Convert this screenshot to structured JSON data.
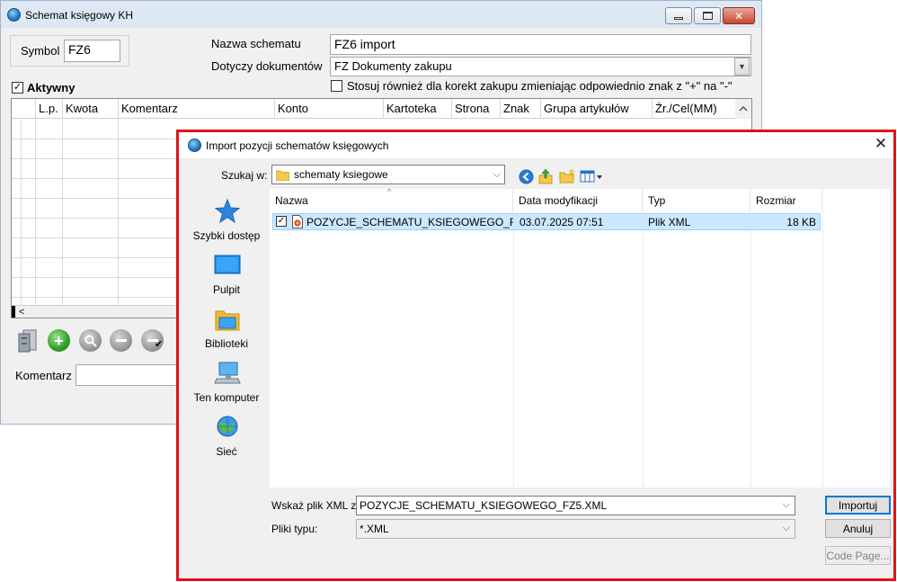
{
  "main_window": {
    "title": "Schemat księgowy KH",
    "controls": {
      "minimize": "▭",
      "maximize": "□",
      "close": "✕"
    },
    "symbol_label": "Symbol",
    "symbol_value": "FZ6",
    "scheme_name_label": "Nazwa schematu",
    "scheme_name_value": "FZ6 import",
    "documents_label": "Dotyczy dokumentów",
    "documents_value": "FZ Dokumenty zakupu",
    "active_label": "Aktywny",
    "active_checked": true,
    "corrections_label": "Stosuj również dla korekt zakupu zmieniając odpowiednio znak z \"+\" na \"-\"",
    "corrections_checked": false,
    "grid_columns": [
      "L.p.",
      "Kwota",
      "Komentarz",
      "Konto",
      "Kartoteka",
      "Strona",
      "Znak",
      "Grupa artykułów",
      "Źr./Cel(MM)"
    ],
    "comment_label": "Komentarz",
    "comment_value": ""
  },
  "dialog": {
    "title": "Import pozycji schematów księgowych",
    "look_in_label": "Szukaj w:",
    "look_in_value": "schematy ksiegowe",
    "places": [
      {
        "label": "Szybki dostęp",
        "icon": "star-icon"
      },
      {
        "label": "Pulpit",
        "icon": "desktop-icon"
      },
      {
        "label": "Biblioteki",
        "icon": "libraries-icon"
      },
      {
        "label": "Ten komputer",
        "icon": "computer-icon"
      },
      {
        "label": "Sieć",
        "icon": "network-icon"
      }
    ],
    "columns": [
      "Nazwa",
      "Data modyfikacji",
      "Typ",
      "Rozmiar"
    ],
    "files": [
      {
        "name": "POZYCJE_SCHEMATU_KSIEGOWEGO_FZ5...",
        "modified": "03.07.2025 07:51",
        "type": "Plik XML",
        "size": "18 KB",
        "checked": true
      }
    ],
    "file_name_label": "Wskaż plik XML z",
    "file_name_value": "POZYCJE_SCHEMATU_KSIEGOWEGO_FZ5.XML",
    "file_type_label": "Pliki typu:",
    "file_type_value": "*.XML",
    "import_button": "Importuj",
    "cancel_button": "Anuluj",
    "codepage_button": "Code Page...",
    "border_color": "#e0141c",
    "selection_color": "#cce8ff"
  }
}
